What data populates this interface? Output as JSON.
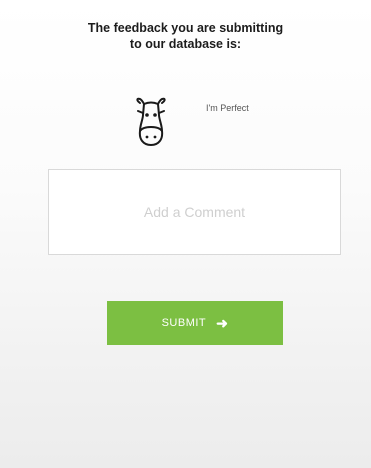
{
  "feedback": {
    "heading_line1": "The feedback you are submitting",
    "heading_line2": "to our database is:",
    "rating_icon": "cow-icon",
    "rating_label": "I'm Perfect"
  },
  "comment": {
    "placeholder": "Add a Comment",
    "value": ""
  },
  "submit": {
    "label": "SUBMIT",
    "icon": "arrow-right-icon",
    "arrow_glyph": "➜"
  },
  "colors": {
    "submit_button": "#7cbf42",
    "heading_text": "#1c1c1c",
    "placeholder_text": "#cfcfcf"
  }
}
